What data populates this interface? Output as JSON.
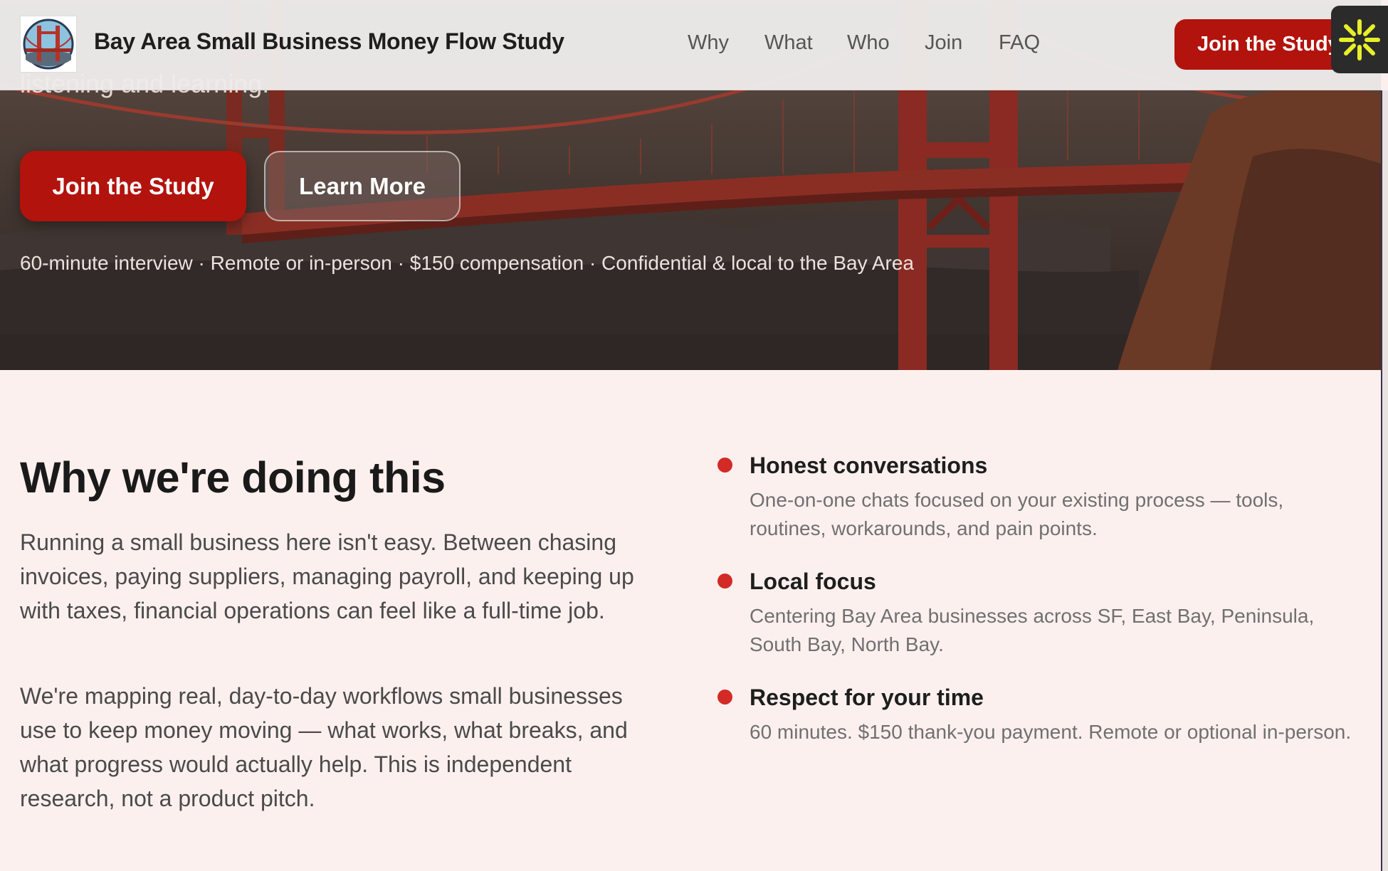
{
  "header": {
    "title": "Bay Area Small Business Money Flow Study",
    "logo_icon": "golden-gate-bridge-logo",
    "nav": [
      "Why",
      "What",
      "Who",
      "Join",
      "FAQ"
    ],
    "cta_label": "Join the Study",
    "widget_icon": "asterisk-burst-icon"
  },
  "hero": {
    "cut_text": "listening and learning.",
    "primary_cta": "Join the Study",
    "secondary_cta": "Learn More",
    "meta": "60-minute interview · Remote or in-person · $150 compensation · Confidential & local to the Bay Area",
    "background": "golden-gate-bridge-photo"
  },
  "why": {
    "title": "Why we're doing this",
    "paragraphs": [
      "Running a small business here isn't easy. Between chasing invoices, paying suppliers, managing payroll, and keeping up with taxes, financial operations can feel like a full-time job.",
      "We're mapping real, day-to-day workflows small businesses use to keep money moving — what works, what breaks, and what progress would actually help. This is independent research, not a product pitch."
    ],
    "features": [
      {
        "title": "Honest conversations",
        "desc": "One-on-one chats focused on your existing process — tools, routines, workarounds, and pain points."
      },
      {
        "title": "Local focus",
        "desc": "Centering Bay Area businesses across SF, East Bay, Peninsula, South Bay, North Bay."
      },
      {
        "title": "Respect for your time",
        "desc": "60 minutes. $150 thank-you payment. Remote or optional in-person."
      }
    ]
  },
  "colors": {
    "accent": "#b2130c",
    "bullet": "#d32a26",
    "section_bg": "#fcf0ee"
  }
}
